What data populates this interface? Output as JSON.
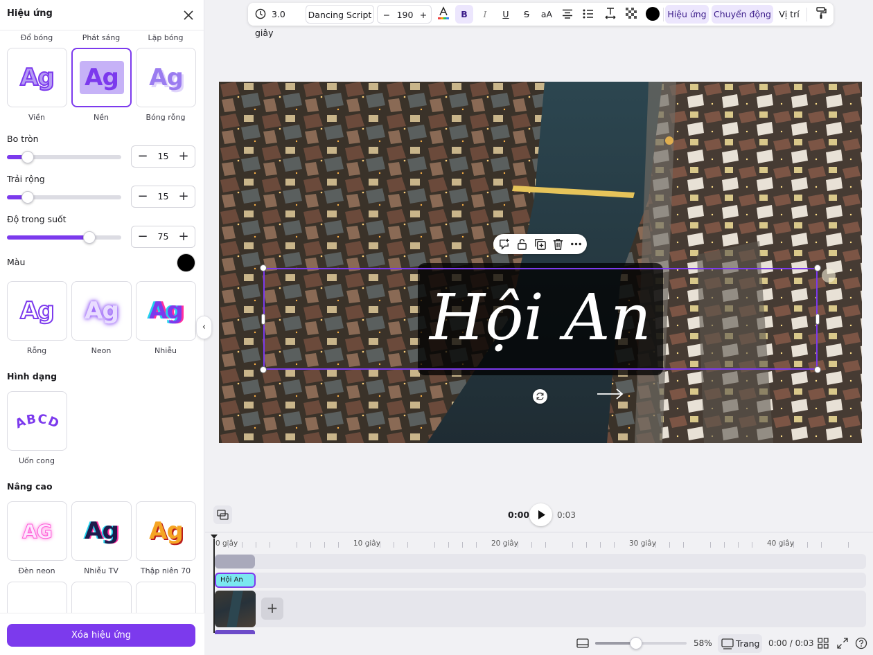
{
  "panel": {
    "title": "Hiệu ứng",
    "top_row_captions": [
      "Đổ bóng",
      "Phát sáng",
      "Lặp bóng"
    ],
    "style_tiles": [
      {
        "label": "Viền",
        "selected": false
      },
      {
        "label": "Nền",
        "selected": true
      },
      {
        "label": "Bóng rỗng",
        "selected": false
      }
    ],
    "sliders": [
      {
        "label": "Bo tròn",
        "value": 15,
        "fraction": 0.18
      },
      {
        "label": "Trải rộng",
        "value": 15,
        "fraction": 0.18
      },
      {
        "label": "Độ trong suốt",
        "value": 75,
        "fraction": 0.72
      }
    ],
    "color_label": "Màu",
    "color_value": "#000000",
    "style_tiles_2": [
      {
        "label": "Rỗng"
      },
      {
        "label": "Neon"
      },
      {
        "label": "Nhiễu"
      }
    ],
    "shape_heading": "Hình dạng",
    "shape_tile": {
      "label": "Uốn cong",
      "sample": "ABCD"
    },
    "advanced_heading": "Nâng cao",
    "advanced_tiles": [
      {
        "label": "Đèn neon"
      },
      {
        "label": "Nhiễu TV"
      },
      {
        "label": "Thập niên 70"
      }
    ],
    "tile_sample": "Ag",
    "neon_sample": "AG",
    "clear_button": "Xóa hiệu ứng"
  },
  "toolbar": {
    "duration": "3.0 giây",
    "font": "Dancing Script",
    "font_size": "190",
    "minus": "−",
    "plus": "+",
    "bold": "B",
    "italic": "I",
    "underline": "U",
    "strike": "S",
    "case": "aA",
    "effects": "Hiệu ứng",
    "animate": "Chuyển động",
    "position": "Vị trí",
    "text_color": "#000000"
  },
  "canvas": {
    "text": "Hội An"
  },
  "playback": {
    "current": "0:00",
    "duration": "0:03"
  },
  "timeline": {
    "ticks": [
      "0 giây",
      "10 giây",
      "20 giây",
      "30 giây",
      "40 giây"
    ],
    "text_clip": "Hội An"
  },
  "bottom": {
    "zoom": "58%",
    "zoom_fraction": 0.45,
    "pages": "Trang",
    "time": "0:00 / 0:03"
  },
  "colors": {
    "accent": "#7c3aed",
    "accent_light": "#ece6fd"
  }
}
